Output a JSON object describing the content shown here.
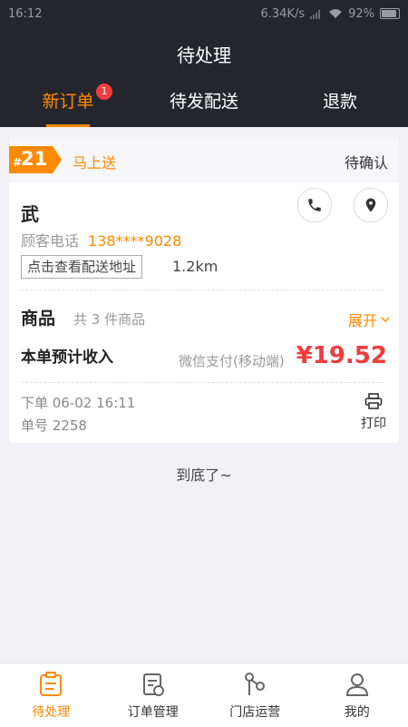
{
  "status_bar": {
    "time": "16:12",
    "network_speed": "6.34K/s",
    "battery": "92%"
  },
  "header": {
    "title": "待处理"
  },
  "tabs": [
    {
      "label": "新订单",
      "badge": "1",
      "active": true
    },
    {
      "label": "待发配送"
    },
    {
      "label": "退款"
    }
  ],
  "order": {
    "hash": "#",
    "number": "21",
    "delivery_type": "马上送",
    "status": "待确认",
    "customer_name": "武",
    "phone_label": "顾客电话",
    "phone": "138****9028",
    "address_button": "点击查看配送地址",
    "distance": "1.2km",
    "goods_title": "商品",
    "goods_count": "共 3 件商品",
    "expand_label": "展开",
    "income_label": "本单预计收入",
    "payment_method": "微信支付(移动端)",
    "income": "¥19.52",
    "order_time": "下单 06-02 16:11",
    "order_id": "单号 2258",
    "print_label": "打印"
  },
  "end_text": "到底了~",
  "bottom_nav": [
    {
      "label": "待处理",
      "active": true
    },
    {
      "label": "订单管理"
    },
    {
      "label": "门店运营"
    },
    {
      "label": "我的"
    }
  ],
  "colors": {
    "accent": "#ff8a00",
    "header_bg": "#25262d",
    "price": "#f03c3c"
  }
}
